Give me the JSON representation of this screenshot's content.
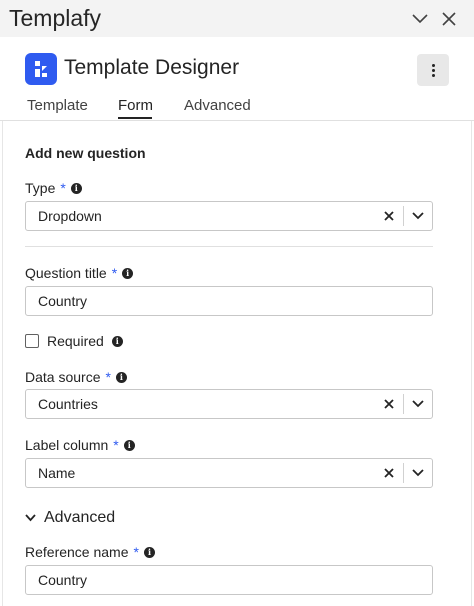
{
  "app": {
    "title": "Templafy"
  },
  "header": {
    "title": "Template Designer"
  },
  "tabs": [
    {
      "label": "Template"
    },
    {
      "label": "Form"
    },
    {
      "label": "Advanced"
    }
  ],
  "form": {
    "heading": "Add new question",
    "type": {
      "label": "Type",
      "required_mark": "*",
      "value": "Dropdown"
    },
    "question_title": {
      "label": "Question title",
      "required_mark": "*",
      "value": "Country"
    },
    "required": {
      "label": "Required",
      "checked": false
    },
    "data_source": {
      "label": "Data source",
      "required_mark": "*",
      "value": "Countries"
    },
    "label_column": {
      "label": "Label column",
      "required_mark": "*",
      "value": "Name"
    },
    "advanced_section": {
      "label": "Advanced",
      "expanded": true
    },
    "reference_name": {
      "label": "Reference name",
      "required_mark": "*",
      "value": "Country"
    }
  },
  "icons": {
    "info": "info-icon",
    "clear": "close-icon",
    "dropdown": "chevron-down-icon",
    "more": "more-vertical-icon"
  },
  "colors": {
    "accent": "#2f5bf0",
    "titlebar_bg": "#f3f3f3"
  }
}
